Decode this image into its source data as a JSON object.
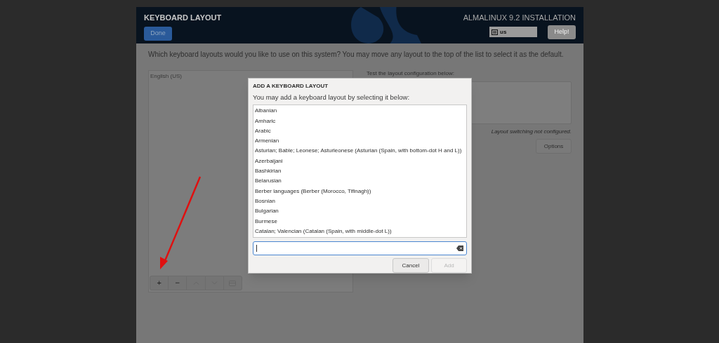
{
  "header": {
    "title": "KEYBOARD LAYOUT",
    "done_button": "Done",
    "product": "ALMALINUX 9.2 INSTALLATION",
    "layout_indicator": "us",
    "help_button": "Help!"
  },
  "prompt": "Which keyboard layouts would you like to use on this system?  You may move any layout to the top of the list to select it as the default.",
  "layouts": [
    {
      "label": "English (US)"
    }
  ],
  "toolbar": [
    {
      "kind": "add",
      "label": "+"
    },
    {
      "kind": "remove",
      "label": "−"
    },
    {
      "kind": "up"
    },
    {
      "kind": "down"
    },
    {
      "kind": "preview"
    }
  ],
  "test": {
    "label": "Test the layout configuration below:"
  },
  "switching_note": "Layout switching not configured.",
  "options_button": "Options",
  "dialog": {
    "title": "ADD A KEYBOARD LAYOUT",
    "subtitle": "You may add a keyboard layout by selecting it below:",
    "items": [
      "Albanian",
      "Amharic",
      "Arabic",
      "Armenian",
      "Asturian; Bable; Leonese; Asturleonese (Asturian (Spain, with bottom-dot H and L))",
      "Azerbaijani",
      "Bashkirian",
      "Belarusian",
      "Berber languages (Berber (Morocco, Tifinagh))",
      "Bosnian",
      "Bulgarian",
      "Burmese",
      "Catalan; Valencian (Catalan (Spain, with middle-dot L))"
    ],
    "cancel_button": "Cancel",
    "add_button": "Add",
    "add_disabled": true
  }
}
